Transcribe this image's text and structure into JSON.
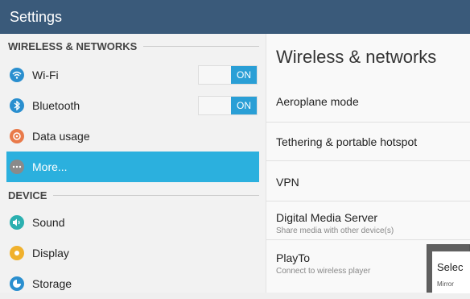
{
  "header": {
    "title": "Settings"
  },
  "sections": {
    "wireless": "WIRELESS & NETWORKS",
    "device": "DEVICE"
  },
  "left_items": {
    "wifi": {
      "label": "Wi-Fi",
      "toggle": "ON",
      "icon": "wifi-icon",
      "color": "#2a8fcf"
    },
    "bluetooth": {
      "label": "Bluetooth",
      "toggle": "ON",
      "icon": "bluetooth-icon",
      "color": "#2a8fcf"
    },
    "data_usage": {
      "label": "Data usage",
      "icon": "data-usage-icon",
      "color": "#e97a4a"
    },
    "more": {
      "label": "More...",
      "icon": "more-icon",
      "color": "#8a8a8a"
    },
    "sound": {
      "label": "Sound",
      "icon": "sound-icon",
      "color": "#2bb0b0"
    },
    "display": {
      "label": "Display",
      "icon": "display-icon",
      "color": "#f0b12d"
    },
    "storage": {
      "label": "Storage",
      "icon": "storage-icon",
      "color": "#2a8fcf"
    }
  },
  "right": {
    "title": "Wireless & networks",
    "items": [
      {
        "label": "Aeroplane mode"
      },
      {
        "label": "Tethering & portable hotspot"
      },
      {
        "label": "VPN"
      },
      {
        "label": "Digital Media Server",
        "sub": "Share media with other device(s)"
      },
      {
        "label": "PlayTo",
        "sub": "Connect to wireless player"
      }
    ]
  },
  "popup": {
    "title": "Selec",
    "subtitle": "Mirror"
  },
  "colors": {
    "header_bg": "#3a5a7a",
    "selected_bg": "#2bb0de",
    "toggle_on": "#2a9fd6"
  }
}
